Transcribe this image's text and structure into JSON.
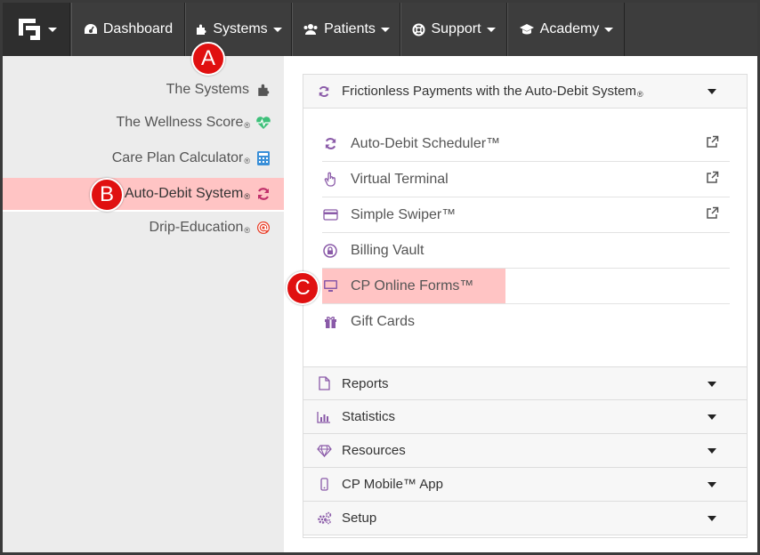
{
  "navbar": {
    "items": [
      {
        "label": "Dashboard",
        "icon": "dashboard-icon"
      },
      {
        "label": "Systems",
        "icon": "puzzle-icon"
      },
      {
        "label": "Patients",
        "icon": "users-icon"
      },
      {
        "label": "Support",
        "icon": "lifebuoy-icon"
      },
      {
        "label": "Academy",
        "icon": "graduation-cap-icon"
      }
    ]
  },
  "sidebar": {
    "items": [
      {
        "label": "The Systems",
        "reg": "",
        "icon": "puzzle-icon",
        "active": false
      },
      {
        "label": "The Wellness Score",
        "reg": "®",
        "icon": "heartbeat-icon",
        "active": false
      },
      {
        "label": "Care Plan Calculator",
        "reg": "®",
        "icon": "calculator-icon",
        "active": false
      },
      {
        "label": "Auto-Debit System",
        "reg": "®",
        "icon": "refresh-icon",
        "active": true
      },
      {
        "label": "Drip-Education",
        "reg": "®",
        "icon": "at-sign-icon",
        "active": false
      }
    ]
  },
  "panel": {
    "open_section": {
      "label": "Frictionless Payments with the Auto-Debit System",
      "reg": "®",
      "icon": "refresh-icon"
    },
    "sub_items": [
      {
        "label": "Auto-Debit Scheduler™",
        "icon": "refresh-icon",
        "external": true
      },
      {
        "label": "Virtual Terminal",
        "icon": "pointer-hand-icon",
        "external": true
      },
      {
        "label": "Simple Swiper™",
        "icon": "credit-card-icon",
        "external": true
      },
      {
        "label": "Billing Vault",
        "icon": "lock-icon",
        "external": false
      },
      {
        "label": "CP Online Forms™",
        "icon": "monitor-icon",
        "external": false
      },
      {
        "label": "Gift Cards",
        "icon": "gift-icon",
        "external": false
      }
    ],
    "sections": [
      {
        "label": "Reports",
        "icon": "file-icon"
      },
      {
        "label": "Statistics",
        "icon": "bar-chart-icon"
      },
      {
        "label": "Resources",
        "icon": "diamond-icon"
      },
      {
        "label": "CP Mobile™ App",
        "icon": "mobile-icon"
      },
      {
        "label": "Setup",
        "icon": "gears-icon"
      }
    ]
  },
  "callouts": {
    "a": "A",
    "b": "B",
    "c": "C"
  },
  "colors": {
    "navbar_bg": "#3d3d3d",
    "highlight": "#ffc4c4",
    "callout": "#e01010",
    "icon_purple": "#8a5aa8",
    "wellness_green": "#3ec07a",
    "calc_blue": "#3a8fd8",
    "drip_red": "#e8402a"
  }
}
